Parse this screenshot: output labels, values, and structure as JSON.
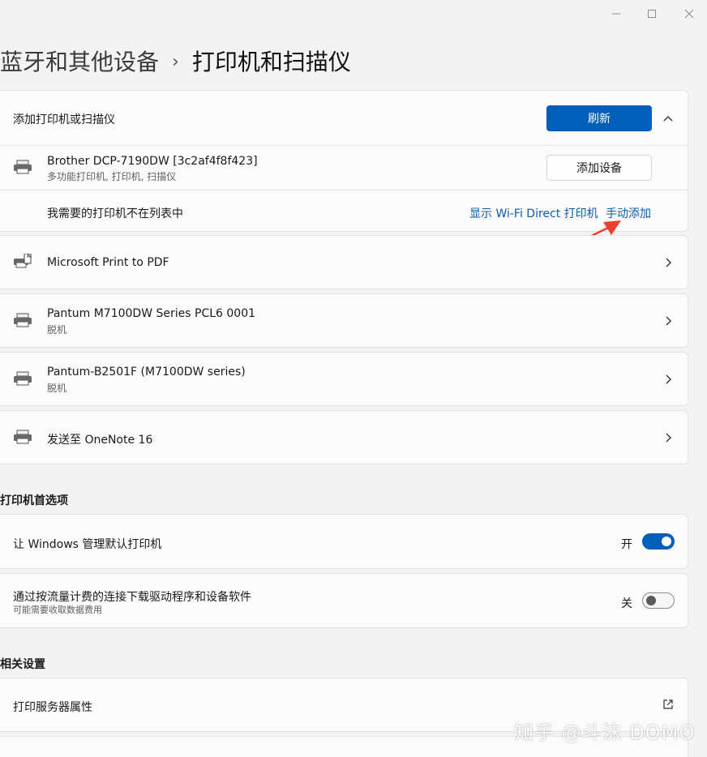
{
  "breadcrumb": {
    "parent": "蓝牙和其他设备",
    "separator": "›",
    "current": "打印机和扫描仪"
  },
  "add_section": {
    "title": "添加打印机或扫描仪",
    "refresh_label": "刷新",
    "found_device": {
      "name": "Brother DCP-7190DW [3c2af4f8f423]",
      "type": "多功能打印机, 打印机, 扫描仪",
      "add_label": "添加设备"
    },
    "not_listed_text": "我需要的打印机不在列表中",
    "wifi_direct_link": "显示 Wi-Fi Direct 打印机",
    "manual_add_link": "手动添加"
  },
  "printers": [
    {
      "name": "Microsoft Print to PDF",
      "status": ""
    },
    {
      "name": "Pantum M7100DW Series PCL6 0001",
      "status": "脱机"
    },
    {
      "name": "Pantum-B2501F (M7100DW series)",
      "status": "脱机"
    },
    {
      "name": "发送至 OneNote 16",
      "status": ""
    }
  ],
  "preferences": {
    "title": "打印机首选项",
    "manage_default": {
      "label": "让 Windows 管理默认打印机",
      "state_label": "开",
      "on": true
    },
    "metered_download": {
      "label": "通过按流量计费的连接下载驱动程序和设备软件",
      "sub": "可能需要收取数据费用",
      "state_label": "关",
      "on": false
    }
  },
  "related": {
    "title": "相关设置",
    "print_server": "打印服务器属性"
  },
  "watermark": "知乎 @斗沫 DOMO",
  "colors": {
    "accent": "#005fb8",
    "link": "#0b5cab",
    "arrow": "#e8412c"
  },
  "icons": [
    "minimize-icon",
    "maximize-icon",
    "close-icon",
    "chevron-right-icon",
    "chevron-up-icon",
    "printer-icon",
    "external-link-icon"
  ]
}
